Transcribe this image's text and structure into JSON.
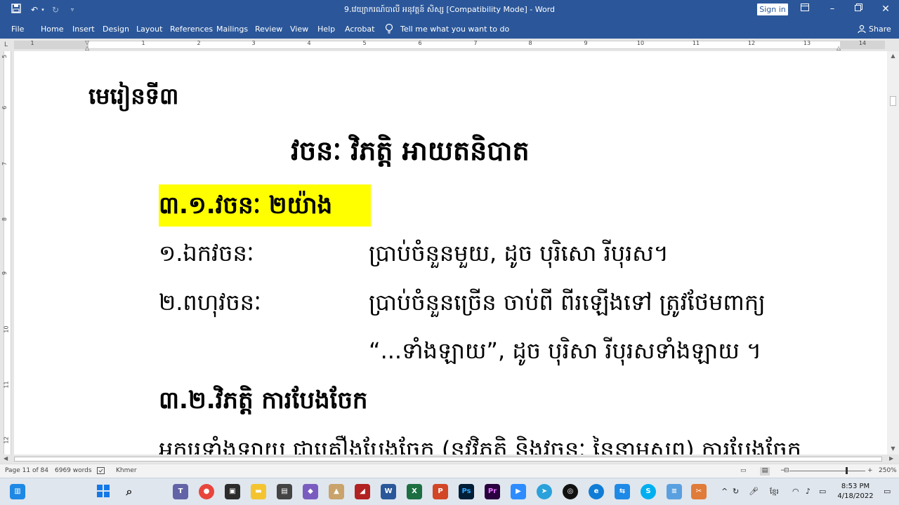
{
  "window": {
    "title": "9.វេយ្យាករណ៍បាលី អនុវត្តន៍ សិស្ស [Compatibility Mode] - Word",
    "sign_in_label": "Sign in"
  },
  "menu": {
    "items": [
      "File",
      "Home",
      "Insert",
      "Design",
      "Layout",
      "References",
      "Mailings",
      "Review",
      "View",
      "Help",
      "Acrobat"
    ],
    "tell_me_placeholder": "Tell me what you want to do",
    "share_label": "Share"
  },
  "ruler": {
    "numbers": [
      "1",
      "1",
      "2",
      "3",
      "4",
      "5",
      "6",
      "7",
      "8",
      "9",
      "10",
      "11",
      "12",
      "13",
      "14"
    ],
    "vertical_numbers": [
      "5",
      "6",
      "7",
      "8",
      "9",
      "10",
      "11",
      "12"
    ]
  },
  "document": {
    "lesson_heading": "មេរៀនទី៣",
    "main_title": "វចនៈ វិភត្តិ អាយតនិបាត",
    "section_31": "៣.១.វចនៈ ២យ៉ាង",
    "singular_term": "១.ឯកវចនៈ",
    "singular_desc": "ប្រាប់ចំនួនមួយ, ដូច បុរិសោ រីបុរស។",
    "plural_term": "២.ពហុវចនៈ",
    "plural_desc": "ប្រាប់ចំនួនច្រើន ចាប់ពី ពីរឡើងទៅ ត្រូវថែមពាក្យ",
    "plural_desc_cont": "“...ទាំងឡាយ”, ដូច បុរិសា រីបុរសទាំងឡាយ ។",
    "section_32": "៣.២.វិភត្តិ ការបែងចែក",
    "partial_line": "អក្សរទាំងឡាយ ជាគ្រឿងបែងចែក (នូវវិភត្តិ និងវចនៈ នៃនាមសព្ទ) ការបែងចែក"
  },
  "status": {
    "page": "Page 11 of 84",
    "words": "6969 words",
    "language": "Khmer",
    "zoom": "250%"
  },
  "clock": {
    "time": "8:53 PM",
    "date": "4/18/2022"
  },
  "colors": {
    "word_blue": "#2b579a",
    "highlight_yellow": "#ffff00"
  }
}
